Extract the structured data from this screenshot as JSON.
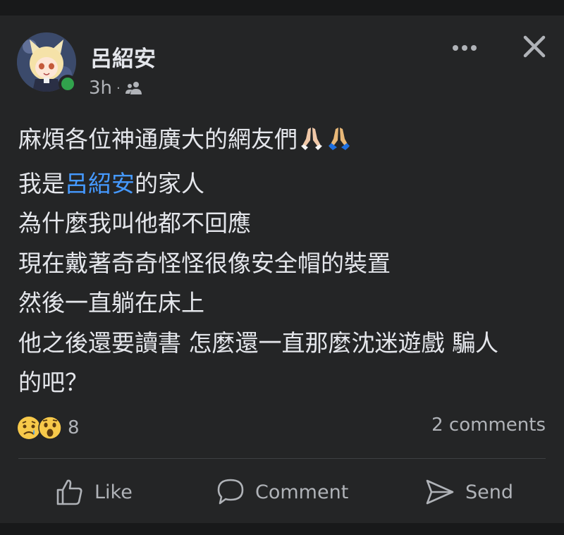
{
  "post": {
    "author": "呂紹安",
    "time": "3h",
    "separator": "·",
    "audience_icon": "friends-icon",
    "body": {
      "line1": "麻煩各位神通廣大的網友們",
      "line2_prefix": "我是",
      "line2_mention": "呂紹安",
      "line2_suffix": "的家人",
      "line3": "為什麼我叫他都不回應",
      "line4": "現在戴著奇奇怪怪很像安全帽的裝置",
      "line5": "然後一直躺在床上",
      "line6": "他之後還要讀書 怎麼還一直那麼沈迷遊戲 騙人",
      "line7": "的吧？"
    }
  },
  "reactions": {
    "icons": [
      "sad-icon",
      "wow-icon"
    ],
    "count": "8"
  },
  "comments_label": "2 comments",
  "actions": {
    "like": "Like",
    "comment": "Comment",
    "send": "Send"
  },
  "colors": {
    "background": "#18191a",
    "card": "#242526",
    "text": "#e4e6eb",
    "secondary_text": "#b0b3b8",
    "mention": "#4599ff",
    "online": "#31a24c"
  }
}
